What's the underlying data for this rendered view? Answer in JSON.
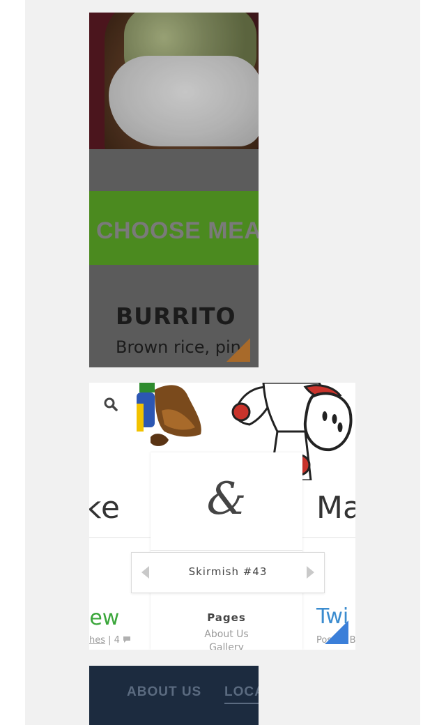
{
  "card_burrito": {
    "banner_text": "CHOOSE MEA",
    "item_title": "BURRITO",
    "item_description": "Brown rice, pin",
    "colors": {
      "green_band": "#4b8a1f",
      "corner_accent": "#a86a2a"
    }
  },
  "card_skirmish": {
    "left_heading": "ke",
    "right_heading": "Ma",
    "logo_symbol": "&",
    "pager_title": "Skirmish #43",
    "left_link": "iew",
    "left_meta_part1": "hes",
    "left_meta_sep": " | ",
    "left_meta_part2": "4",
    "right_link": "Twi",
    "right_meta": "Posted B",
    "pages_title": "Pages",
    "pages_links": [
      "About Us",
      "Gallery"
    ],
    "colors": {
      "green_link": "#3aa63a",
      "blue_link": "#3b8ccf",
      "corner_accent": "#3b7fd9"
    },
    "icons": [
      "search-icon",
      "comment-icon",
      "chevron-left-icon",
      "chevron-right-icon"
    ]
  },
  "card_nav": {
    "items": [
      "ABOUT US",
      "LOCA"
    ],
    "colors": {
      "background": "#1c2b3f",
      "text": "#5b6b80"
    }
  }
}
